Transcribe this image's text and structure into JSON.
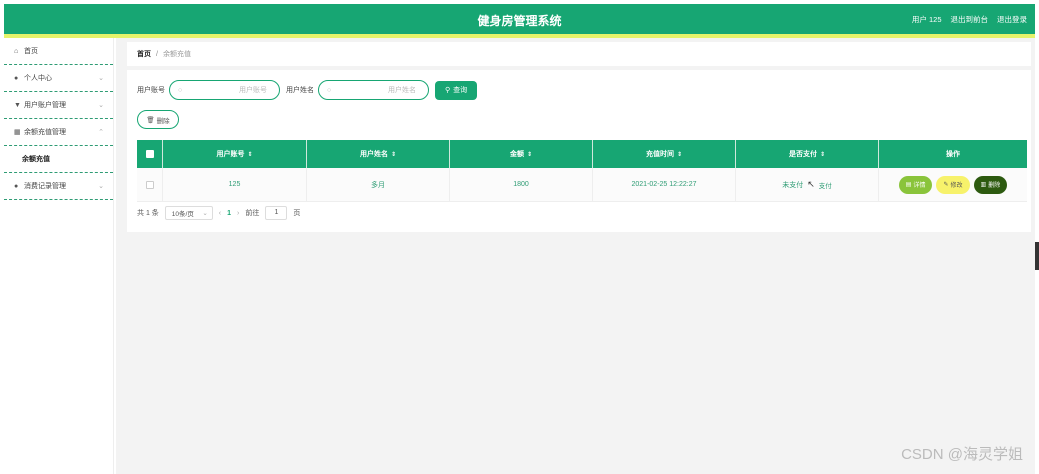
{
  "header": {
    "title": "健身房管理系统",
    "user": "用户 125",
    "back_to_front": "退出到前台",
    "logout": "退出登录"
  },
  "sidebar": {
    "items": [
      {
        "label": "首页",
        "icon": "home-icon"
      },
      {
        "label": "个人中心",
        "icon": "user-icon"
      },
      {
        "label": "用户账户管理",
        "icon": "shield-icon"
      },
      {
        "label": "余额充值管理",
        "icon": "table-icon"
      },
      {
        "label": "消费记录管理",
        "icon": "user-icon"
      }
    ],
    "sub_item": "余额充值"
  },
  "breadcrumb": {
    "home": "首页",
    "separator": "/",
    "current": "余额充值"
  },
  "search": {
    "account_label": "用户账号",
    "account_placeholder": "用户账号",
    "name_label": "用户姓名",
    "name_placeholder": "用户姓名",
    "query_button": "查询"
  },
  "delete_button": "删除",
  "table": {
    "columns": [
      "用户账号",
      "用户姓名",
      "金额",
      "充值时间",
      "是否支付",
      "操作"
    ],
    "rows": [
      {
        "account": "125",
        "name": "多月",
        "amount": "1800",
        "time": "2021-02-25 12:22:27",
        "paid": "未支付",
        "pay_link": "支付",
        "actions": {
          "detail": "详情",
          "edit": "修改",
          "delete": "删除"
        }
      }
    ]
  },
  "pager": {
    "total": "共 1 条",
    "page_size": "10条/页",
    "current_page": "1",
    "goto_label": "前往",
    "goto_value": "1",
    "page_unit": "页"
  },
  "colors": {
    "primary": "#17a673",
    "accent_bar": "#e5f36a",
    "detail_btn": "#8ac43b",
    "edit_btn": "#f7f26b",
    "delete_btn": "#2d5a10"
  },
  "watermark": "CSDN @海灵学姐"
}
